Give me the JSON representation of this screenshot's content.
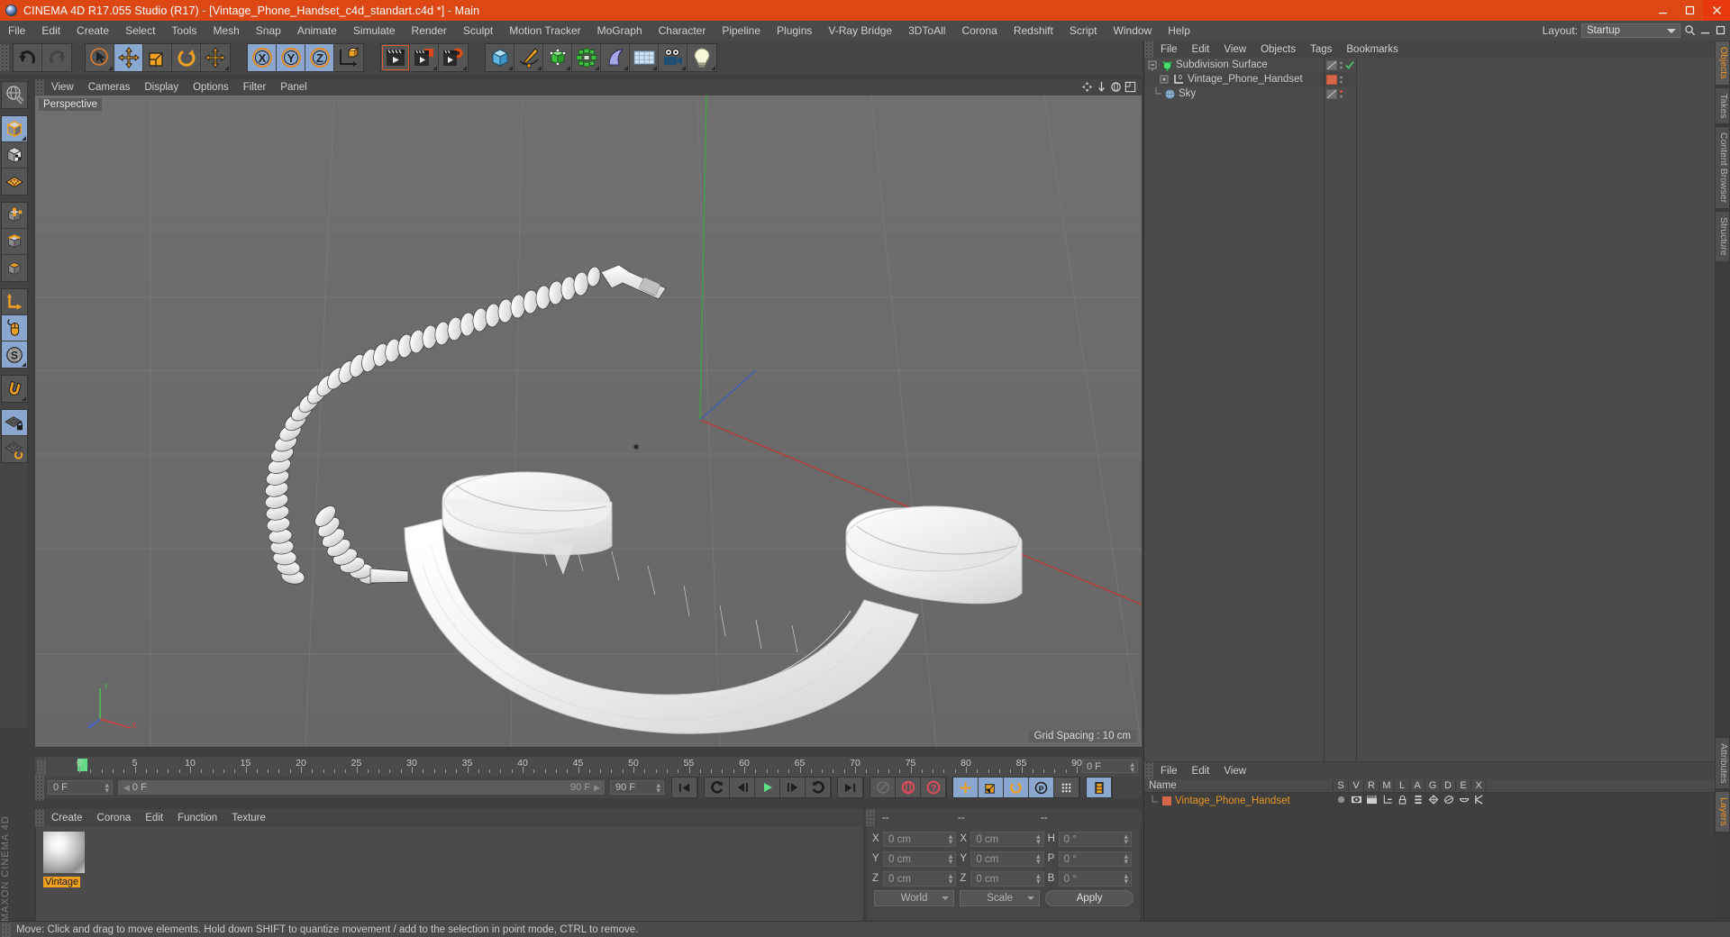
{
  "window": {
    "title": "CINEMA 4D R17.055 Studio (R17) - [Vintage_Phone_Handset_c4d_standart.c4d *] - Main",
    "buttons": {
      "minimize": "minimize-icon",
      "maximize": "maximize-icon",
      "close": "close-icon"
    },
    "accent": "#dd4713"
  },
  "menubar": {
    "items": [
      "File",
      "Edit",
      "Create",
      "Select",
      "Tools",
      "Mesh",
      "Snap",
      "Animate",
      "Simulate",
      "Render",
      "Sculpt",
      "Motion Tracker",
      "MoGraph",
      "Character",
      "Pipeline",
      "Plugins",
      "V-Ray Bridge",
      "3DToAll",
      "Corona",
      "Redshift",
      "Script",
      "Window",
      "Help"
    ],
    "layout_label": "Layout:",
    "layout_value": "Startup"
  },
  "toolbar": {
    "groups": [
      {
        "name": "undo-redo",
        "buttons": [
          {
            "name": "undo-button",
            "icon": "undo-arrow",
            "state": "normal"
          },
          {
            "name": "redo-button",
            "icon": "redo-arrow",
            "state": "disabled"
          }
        ]
      },
      {
        "name": "transform-tools",
        "buttons": [
          {
            "name": "live-selection-tool",
            "icon": "cursor-circle",
            "state": "normal"
          },
          {
            "name": "move-tool",
            "icon": "move-arrows",
            "state": "active"
          },
          {
            "name": "scale-tool",
            "icon": "scale-box",
            "state": "normal"
          },
          {
            "name": "rotate-tool",
            "icon": "rotate-arc",
            "state": "normal"
          },
          {
            "name": "move-duplicate-tool",
            "icon": "move-arrows",
            "state": "normal"
          }
        ]
      },
      {
        "name": "axis-locks",
        "buttons": [
          {
            "name": "lock-x-axis-button",
            "icon": "x-ring",
            "state": "active"
          },
          {
            "name": "lock-y-axis-button",
            "icon": "y-ring",
            "state": "active"
          },
          {
            "name": "lock-z-axis-button",
            "icon": "z-ring",
            "state": "active"
          },
          {
            "name": "world-object-coordinate-button",
            "icon": "axis-cube",
            "state": "normal"
          }
        ]
      },
      {
        "name": "render-group",
        "buttons": [
          {
            "name": "render-view-button",
            "icon": "clapper-view",
            "state": "selected"
          },
          {
            "name": "render-to-picture-viewer-button",
            "icon": "clapper-picture",
            "state": "normal"
          },
          {
            "name": "render-settings-button",
            "icon": "clapper-gear",
            "state": "normal"
          }
        ]
      },
      {
        "name": "object-group",
        "buttons": [
          {
            "name": "add-cube-button",
            "icon": "cube-blue",
            "state": "normal"
          },
          {
            "name": "add-spline-button",
            "icon": "pen-spline",
            "state": "normal"
          },
          {
            "name": "add-array-button",
            "icon": "green-cube",
            "state": "normal"
          },
          {
            "name": "add-mograph-button",
            "icon": "green-cluster",
            "state": "normal"
          },
          {
            "name": "add-deformer-button",
            "icon": "bend-shape",
            "state": "normal"
          },
          {
            "name": "add-scene-button",
            "icon": "floor-grid",
            "state": "normal"
          },
          {
            "name": "add-camera-button",
            "icon": "camera",
            "state": "normal"
          },
          {
            "name": "add-light-button",
            "icon": "light-bulb",
            "state": "normal"
          }
        ]
      }
    ]
  },
  "lefttool": {
    "buttons": [
      {
        "name": "make-editable-button",
        "icon": "globe-wrench",
        "state": "normal"
      },
      {
        "name": "model-mode-button",
        "icon": "cube-mode",
        "state": "active"
      },
      {
        "name": "texture-mode-button",
        "icon": "checker-cube",
        "state": "normal"
      },
      {
        "name": "workplane-mode-button",
        "icon": "orange-grid",
        "state": "normal"
      },
      {
        "name": "points-mode-button",
        "icon": "point-cube",
        "state": "normal"
      },
      {
        "name": "edges-mode-button",
        "icon": "edge-cube",
        "state": "normal"
      },
      {
        "name": "polygons-mode-button",
        "icon": "poly-cube",
        "state": "normal"
      },
      {
        "name": "object-axis-button",
        "icon": "axis-l",
        "state": "normal"
      },
      {
        "name": "viewport-interaction-button",
        "icon": "mouse",
        "state": "active"
      },
      {
        "name": "snap-button",
        "icon": "s-circle",
        "state": "active"
      },
      {
        "name": "magnet-button",
        "icon": "magnet",
        "state": "normal"
      },
      {
        "name": "workplane-lock-button",
        "icon": "grid-lock",
        "state": "active"
      },
      {
        "name": "workplane-rotate-button",
        "icon": "grid-rotate",
        "state": "normal"
      }
    ]
  },
  "viewport": {
    "menu": [
      "View",
      "Cameras",
      "Display",
      "Options",
      "Filter",
      "Panel"
    ],
    "label": "Perspective",
    "grid_spacing": "Grid Spacing : 10 cm",
    "axis_gizmo": {
      "x": "X",
      "y": "Y",
      "z": "Z"
    },
    "corner_icons": [
      "pan-icon",
      "dolly-icon",
      "rotate-icon",
      "maximize-view-icon"
    ]
  },
  "object_manager": {
    "menu": [
      "File",
      "Edit",
      "View",
      "Objects",
      "Tags",
      "Bookmarks"
    ],
    "rows": [
      {
        "name": "Subdivision Surface",
        "depth": 0,
        "icon": "subdivision-surface-icon",
        "icon_color": "#4ddc6e",
        "tag_color": "#6f6f6f",
        "enabled": true,
        "check": true
      },
      {
        "name": "Vintage_Phone_Handset",
        "depth": 1,
        "icon": "null-object-icon",
        "icon_color": "#d8d8d8",
        "tag_color": "#d4674a",
        "enabled": true,
        "check": false
      },
      {
        "name": "Sky",
        "depth": 0,
        "icon": "sky-object-icon",
        "icon_color": "#9bb7d4",
        "tag_color": "#6f6f6f",
        "enabled": true,
        "check": false
      }
    ]
  },
  "timeline": {
    "start_field": "0 F",
    "current_field": "0 F",
    "end_field_preview": "90 F",
    "end_field": "90 F",
    "right_field": "0 F",
    "ticks": [
      0,
      5,
      10,
      15,
      20,
      25,
      30,
      35,
      40,
      45,
      50,
      55,
      60,
      65,
      70,
      75,
      80,
      85,
      90
    ],
    "range_min": 0,
    "range_max": 90,
    "playhead": 0,
    "transport": [
      {
        "name": "go-to-start-button",
        "icon": "skip-start",
        "state": "normal"
      },
      {
        "name": "go-to-previous-key-button",
        "icon": "prev-key",
        "state": "normal"
      },
      {
        "name": "go-to-previous-frame-button",
        "icon": "prev-frame",
        "state": "normal"
      },
      {
        "name": "play-button",
        "icon": "play",
        "state": "normal"
      },
      {
        "name": "go-to-next-frame-button",
        "icon": "next-frame",
        "state": "normal"
      },
      {
        "name": "go-to-next-key-button",
        "icon": "next-key",
        "state": "normal"
      },
      {
        "name": "go-to-end-button",
        "icon": "skip-end",
        "state": "normal"
      },
      {
        "name": "record-active-objects-button",
        "icon": "record-disabled",
        "state": "disabled"
      },
      {
        "name": "autokeying-button",
        "icon": "autokey",
        "state": "normal"
      },
      {
        "name": "keyframe-selection-button",
        "icon": "key-question",
        "state": "normal"
      },
      {
        "name": "position-key-button",
        "icon": "pos-key",
        "state": "active"
      },
      {
        "name": "scale-key-button",
        "icon": "scale-key",
        "state": "active"
      },
      {
        "name": "rotation-key-button",
        "icon": "rot-key",
        "state": "active"
      },
      {
        "name": "parameter-key-button",
        "icon": "param-key",
        "state": "active"
      },
      {
        "name": "point-level-animation-button",
        "icon": "pla-dots",
        "state": "normal"
      },
      {
        "name": "timeline-button",
        "icon": "film-strip",
        "state": "normal"
      }
    ]
  },
  "material_manager": {
    "menu": [
      "Create",
      "Corona",
      "Edit",
      "Function",
      "Texture"
    ],
    "materials": [
      {
        "name": "Vintage",
        "preview": "white-sphere"
      }
    ]
  },
  "coordinates": {
    "headers": [
      "--",
      "--",
      "--"
    ],
    "position": {
      "label_x": "X",
      "label_y": "Y",
      "label_z": "Z",
      "x": "0 cm",
      "y": "0 cm",
      "z": "0 cm"
    },
    "size": {
      "label_x": "X",
      "label_y": "Y",
      "label_z": "Z",
      "x": "0 cm",
      "y": "0 cm",
      "z": "0 cm"
    },
    "rotation": {
      "label_h": "H",
      "label_p": "P",
      "label_b": "B",
      "h": "0 °",
      "p": "0 °",
      "b": "0 °"
    },
    "system": "World",
    "mode": "Scale",
    "apply": "Apply"
  },
  "attributes": {
    "menu": [
      "File",
      "Edit",
      "View"
    ],
    "name_header": "Name",
    "columns": [
      "S",
      "V",
      "R",
      "M",
      "L",
      "A",
      "G",
      "D",
      "E",
      "X"
    ],
    "rows": [
      {
        "name": "Vintage_Phone_Handset",
        "swatch": "#d4674a",
        "icons": [
          "sphere-icon",
          "eye-icon",
          "clapper-icon",
          "connector-icon",
          "lock-icon",
          "layer-icon",
          "deform-icon",
          "shade-icon",
          "cap-icon",
          "k-icon"
        ]
      }
    ]
  },
  "right_tabs": {
    "top": [
      {
        "label": "Objects",
        "active": true
      },
      {
        "label": "Takes",
        "active": false
      },
      {
        "label": "Content Browser",
        "active": false
      },
      {
        "label": "Structure",
        "active": false
      }
    ],
    "bottom": [
      {
        "label": "Attributes",
        "active": false
      },
      {
        "label": "Layers",
        "active": true
      }
    ]
  },
  "brand": "MAXON CINEMA 4D",
  "statusbar": {
    "text": "Move: Click and drag to move elements. Hold down SHIFT to quantize movement / add to the selection in point mode, CTRL to remove."
  }
}
